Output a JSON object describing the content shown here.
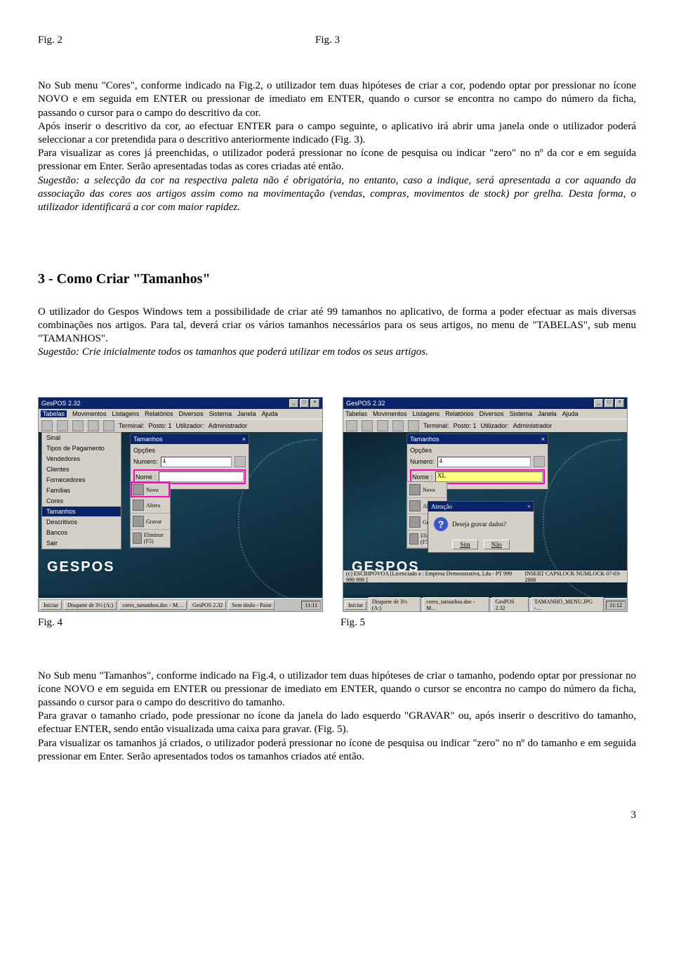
{
  "figs_top": {
    "left": "Fig. 2",
    "right": "Fig. 3"
  },
  "para1": "No Sub menu \"Cores\", conforme indicado na Fig.2, o utilizador tem duas hipóteses de criar a cor, podendo optar por pressionar no ícone NOVO e em seguida em ENTER ou pressionar de imediato em ENTER, quando o cursor se encontra no campo do número da ficha, passando o cursor para o campo do descritivo da cor.",
  "para2": "Após inserir o descritivo da cor, ao efectuar ENTER para o campo seguinte, o aplicativo irá abrir uma janela onde o utilizador poderá seleccionar a cor pretendida para o descritivo anteriormente indicado (Fig. 3).",
  "para3": "Para visualizar as cores já preenchidas, o utilizador poderá pressionar no ícone de pesquisa ou indicar \"zero\" no nº da cor e em seguida pressionar em Enter. Serão apresentadas todas as cores criadas até então.",
  "para4_lead": "Sugestão:",
  "para4": " a selecção da cor na respectiva paleta não é obrigatória, no entanto, caso a indique, será apresentada a cor aquando da associação das cores aos artigos assim como na movimentação (vendas, compras, movimentos de stock) por grelha. Desta forma, o utilizador identificará a cor com maior rapidez.",
  "heading": "3 - Como Criar \"Tamanhos\"",
  "para5": "O utilizador do Gespos Windows tem a possibilidade de criar até 99 tamanhos no aplicativo, de forma a poder efectuar as mais diversas combinações nos artigos. Para tal, deverá criar os vários tamanhos necessários para os seus artigos, no menu de \"TABELAS\", sub menu \"TAMANHOS\".",
  "para6_lead": "Sugestão:",
  "para6": " Crie inicialmente todos os tamanhos que poderá utilizar em todos os seus artigos.",
  "figs_bottom": {
    "left": "Fig. 4",
    "right": "Fig. 5"
  },
  "para7": "No Sub menu \"Tamanhos\", conforme indicado na Fig.4, o utilizador tem duas hipóteses de criar o tamanho, podendo optar por pressionar no ícone NOVO e em seguida em ENTER ou pressionar de imediato em ENTER, quando o cursor se encontra no campo do número da ficha, passando o cursor para o campo do descritivo do tamanho.",
  "para8": "Para gravar o tamanho criado, pode pressionar no ícone da janela do lado esquerdo \"GRAVAR\" ou, após inserir o descritivo do tamanho, efectuar ENTER, sendo então visualizada uma caixa para gravar. (Fig. 5).",
  "para9": "Para visualizar os tamanhos já criados, o utilizador poderá pressionar no ícone de pesquisa ou indicar \"zero\" no nº do tamanho e em seguida pressionar em Enter. Serão apresentados todos os tamanhos criados até então.",
  "page_number": "3",
  "screenshot": {
    "app_title": "GesPOS 2.32",
    "menubar": [
      "Tabelas",
      "Movimentos",
      "Listagens",
      "Relatórios",
      "Diversos",
      "Sistema",
      "Janela",
      "Ajuda"
    ],
    "toolbar_labels": {
      "terminal": "Terminal:",
      "posto": "Posto: 1",
      "utilizador": "Utilizador:",
      "admin": "Administrador"
    },
    "dropdown_items": [
      "Sinal",
      "Tipos de Pagamento",
      "Vendedores",
      "Clientes",
      "Fornecedores",
      "Famílias",
      "Cores",
      "Tamanhos",
      "Descritivos",
      "Bancos",
      "Sair"
    ],
    "dialog_title": "Tamanhos",
    "opcoes": "Opções",
    "numero": "Numero:",
    "numero_val": "4",
    "nome": "Nome :",
    "nome_val": "XL",
    "side_buttons": [
      "Novo",
      "Altera",
      "Gravar",
      "Eliminar (F5)"
    ],
    "logo": "GESPOS",
    "statusbar": "(c) ESCRIPOVOA [Licenciado a : Empresa Demonstrativa, Lda - PT 999 999 999 ]",
    "statusbar_right": "INSERT   CAPSLOCK   NUMLOCK   07-03-2000",
    "taskbar": {
      "start": "Iniciar",
      "items": [
        "Disquete de 3½ (A:)",
        "cores_tamanhos.doc - M…",
        "GesPOS 2.32",
        "Sem título - Paint",
        "TAMANHO_MENU.JPG -…"
      ],
      "clock": "11:11",
      "clock2": "11:12"
    },
    "alert_title": "Atenção",
    "alert_msg": "Deseja gravar dados?",
    "alert_yes": "Sim",
    "alert_no": "Não"
  }
}
